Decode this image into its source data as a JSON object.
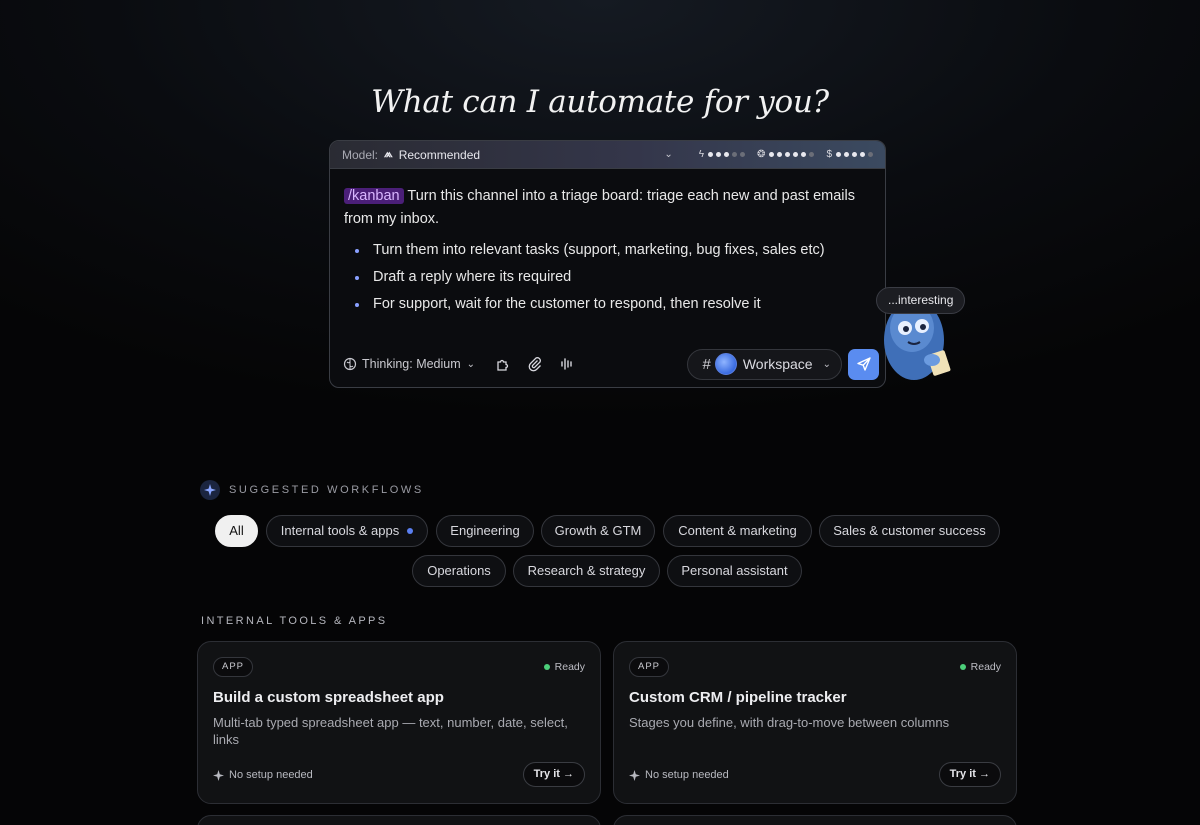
{
  "hero": {
    "title": "What can I automate for you?"
  },
  "composer": {
    "model_label": "Model:",
    "model_name": "Recommended",
    "command_tag": "/kanban",
    "prompt_text": " Turn this channel into a triage board: triage each new and past emails from my inbox.",
    "bullets": [
      "Turn them into relevant tasks (support, marketing, bug fixes, sales etc)",
      "Draft a reply where its required",
      "For support, wait for the customer to respond, then resolve it"
    ],
    "thinking_label": "Thinking: Medium",
    "workspace_label": "Workspace",
    "meters": [
      {
        "icon": "lightning-icon",
        "level": 3,
        "max": 5
      },
      {
        "icon": "brain-icon",
        "level": 5,
        "max": 6
      },
      {
        "icon": "dollar-icon",
        "level": 4,
        "max": 5
      }
    ]
  },
  "mascot": {
    "bubble_text": "...interesting"
  },
  "suggested": {
    "header": "SUGGESTED WORKFLOWS",
    "chips": [
      {
        "label": "All",
        "active": true
      },
      {
        "label": "Internal tools & apps",
        "dot": true
      },
      {
        "label": "Engineering"
      },
      {
        "label": "Growth & GTM"
      },
      {
        "label": "Content & marketing"
      },
      {
        "label": "Sales & customer success"
      },
      {
        "label": "Operations"
      },
      {
        "label": "Research & strategy"
      },
      {
        "label": "Personal assistant"
      }
    ],
    "section_label": "INTERNAL TOOLS & APPS",
    "cards": [
      {
        "badge": "APP",
        "status": "Ready",
        "title": "Build a custom spreadsheet app",
        "description": "Multi-tab typed spreadsheet app — text, number, date, select, links",
        "setup": "No setup needed",
        "cta": "Try it →"
      },
      {
        "badge": "APP",
        "status": "Ready",
        "title": "Custom CRM / pipeline tracker",
        "description": "Stages you define, with drag-to-move between columns",
        "setup": "No setup needed",
        "cta": "Try it →"
      }
    ]
  },
  "colors": {
    "accent_blue": "#5a8cf0",
    "command_bg": "#4b1f78",
    "ready_green": "#4ccf7a"
  }
}
